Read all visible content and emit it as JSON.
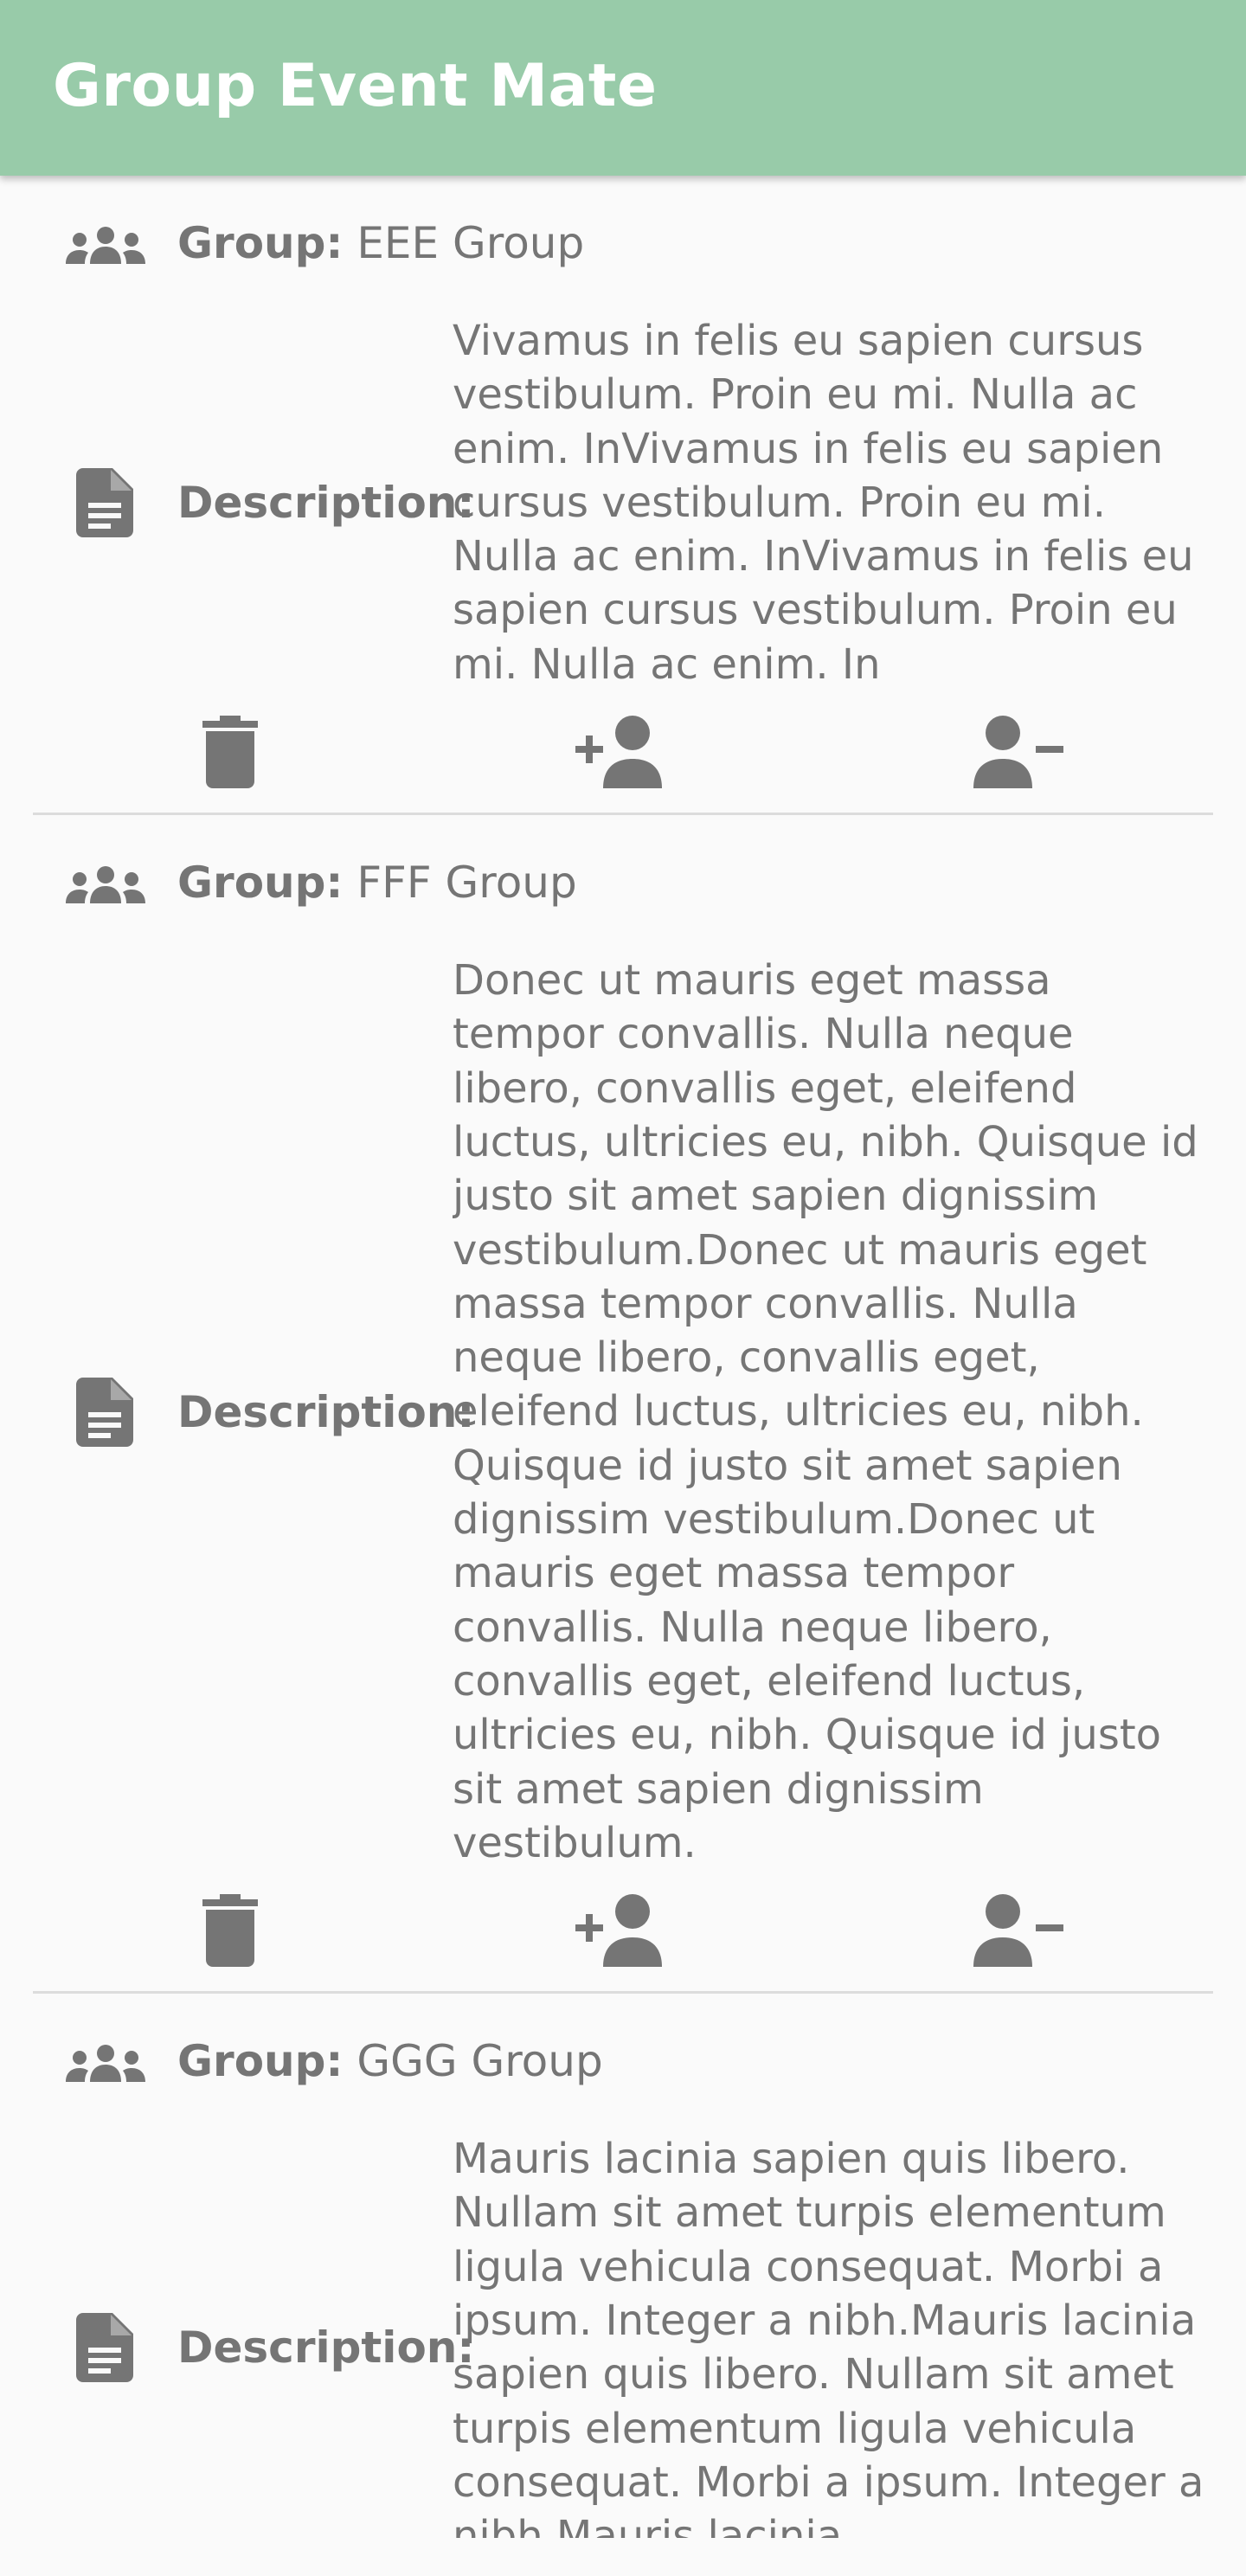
{
  "app": {
    "title": "Group Event Mate"
  },
  "labels": {
    "group": "Group:",
    "description": "Description:"
  },
  "groups": [
    {
      "name": "EEE Group",
      "description": "Vivamus in felis eu sapien cursus vestibulum. Proin eu mi. Nulla ac enim. InVivamus in felis eu sapien cursus vestibulum. Proin eu mi. Nulla ac enim. InVivamus in felis eu sapien cursus vestibulum. Proin eu mi. Nulla ac enim. In"
    },
    {
      "name": "FFF Group",
      "description": "Donec ut mauris eget massa tempor convallis. Nulla neque libero, convallis eget, eleifend luctus, ultricies eu, nibh. Quisque id justo sit amet sapien dignissim vestibulum.Donec ut mauris eget massa tempor convallis. Nulla neque libero, convallis eget, eleifend luctus, ultricies eu, nibh. Quisque id justo sit amet sapien dignissim vestibulum.Donec ut mauris eget massa tempor convallis. Nulla neque libero, convallis eget, eleifend luctus, ultricies eu, nibh. Quisque id justo sit amet sapien dignissim vestibulum."
    },
    {
      "name": "GGG Group",
      "description": "Mauris lacinia sapien quis libero. Nullam sit amet turpis elementum ligula vehicula consequat. Morbi a ipsum. Integer a nibh.Mauris lacinia sapien quis libero. Nullam sit amet turpis elementum ligula vehicula consequat. Morbi a ipsum. Integer a nibh.Mauris lacinia"
    }
  ],
  "icons": {
    "group": "group-icon",
    "description": "document-icon",
    "delete": "trash-icon",
    "add_member": "person-add-icon",
    "remove_member": "person-remove-icon"
  },
  "colors": {
    "appbar": "#98cba9",
    "icon": "#757575",
    "text": "#757575",
    "background": "#fafafa",
    "divider": "#dcdcdc"
  }
}
